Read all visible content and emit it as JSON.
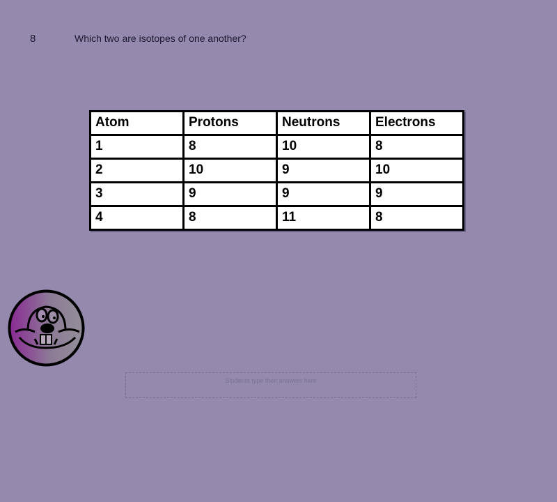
{
  "question": {
    "number": "8",
    "text": "Which two are isotopes of one another?"
  },
  "table": {
    "headers": [
      "Atom",
      "Protons",
      "Neutrons",
      "Electrons"
    ],
    "rows": [
      [
        "1",
        "8",
        "10",
        "8"
      ],
      [
        "2",
        "10",
        "9",
        "10"
      ],
      [
        "3",
        "9",
        "9",
        "9"
      ],
      [
        "4",
        "8",
        "11",
        "8"
      ]
    ]
  },
  "mascot": {
    "icon": "beaver-mascot-icon"
  },
  "answer_box": {
    "placeholder": "Students type their answers here"
  }
}
